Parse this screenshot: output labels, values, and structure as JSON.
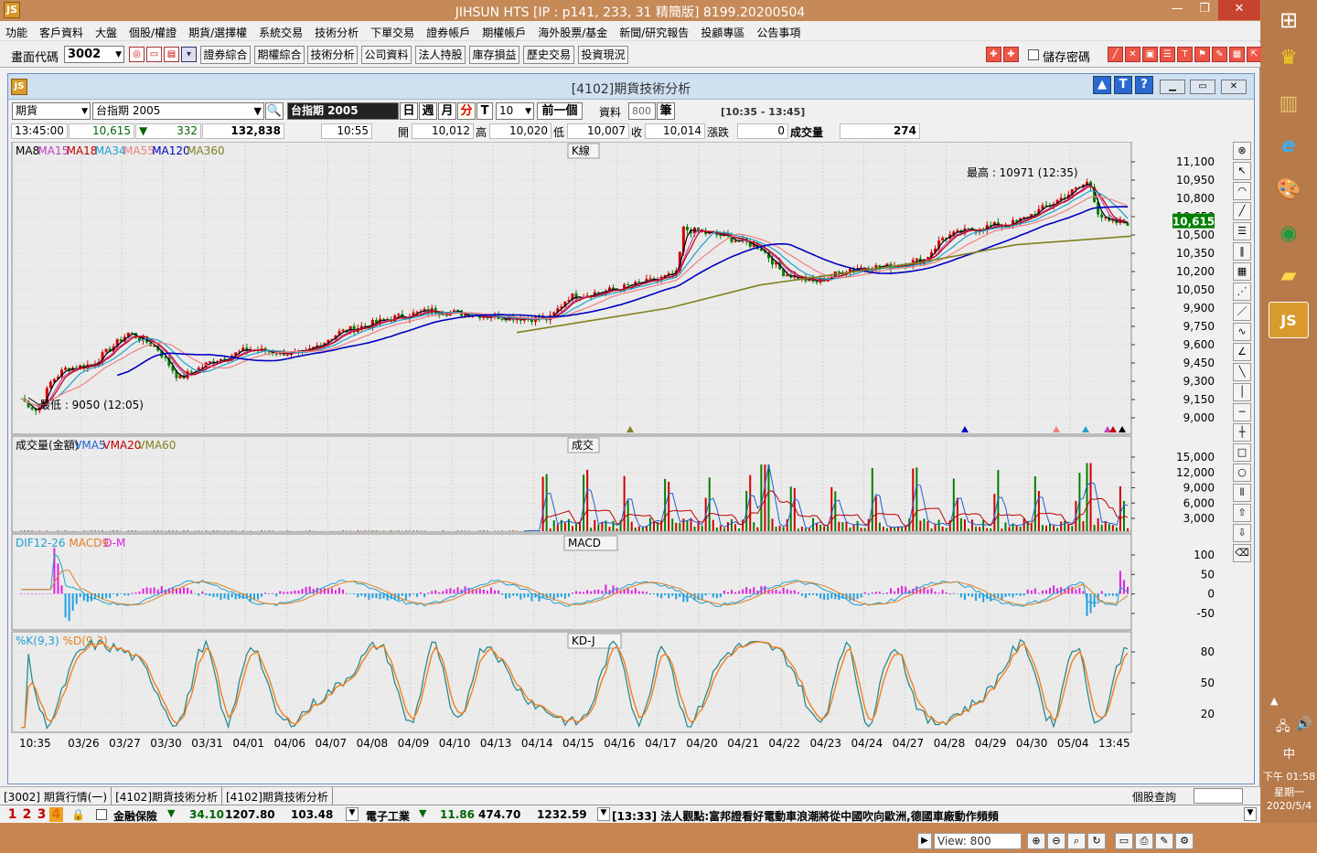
{
  "app": {
    "title": "JIHSUN HTS      [IP : p141, 233, 31 精簡版] 8199.20200504",
    "logo": "JS"
  },
  "menu": [
    "功能",
    "客戶資料",
    "大盤",
    "個股/權證",
    "期貨/選擇權",
    "系統交易",
    "技術分析",
    "下單交易",
    "證券帳戶",
    "期權帳戶",
    "海外股票/基金",
    "新聞/研究報告",
    "投顧專區",
    "公告事項"
  ],
  "toolbar": {
    "code_label": "畫面代碼",
    "code_value": "3002",
    "buttons": [
      "證券綜合",
      "期權綜合",
      "技術分析",
      "公司資料",
      "法人持股",
      "庫存損益",
      "歷史交易",
      "投資現況"
    ],
    "save_password_label": "儲存密碼"
  },
  "child": {
    "title": "[4102]期貨技術分析",
    "type_value": "期貨",
    "symbol_value": "台指期 2005",
    "symbol_display": "台指期 2005",
    "period_day": "日",
    "period_week": "週",
    "period_month": "月",
    "period_min": "分",
    "period_t": "T",
    "interval_value": "10",
    "prev_button": "前一個",
    "data_label": "資料",
    "data_count": "800",
    "count_unit": "筆",
    "time_range": "[10:35 - 13:45]"
  },
  "quote": {
    "time": "13:45:00",
    "price": "10,615",
    "change": "332",
    "volume_total": "132,838",
    "bar_time": "10:55",
    "open_label": "開",
    "open": "10,012",
    "high_label": "高",
    "high": "10,020",
    "low_label": "低",
    "low": "10,007",
    "close_label": "收",
    "close": "10,014",
    "chg_label": "漲跌",
    "chg": "0",
    "vol_label": "成交量",
    "vol": "274"
  },
  "panels": {
    "k": {
      "label": "K線",
      "ma_legend": [
        {
          "name": "MA8",
          "color": "#000000"
        },
        {
          "name": "MA15",
          "color": "#c040c0"
        },
        {
          "name": "MA18",
          "color": "#c00000"
        },
        {
          "name": "MA34",
          "color": "#20a0d0"
        },
        {
          "name": "MA55",
          "color": "#f08080"
        },
        {
          "name": "MA120",
          "color": "#0000c0"
        },
        {
          "name": "MA360",
          "color": "#808020"
        }
      ],
      "y_ticks": [
        "11,100",
        "10,950",
        "10,800",
        "10,650",
        "10,500",
        "10,350",
        "10,200",
        "10,050",
        "9,900",
        "9,750",
        "9,600",
        "9,450",
        "9,300",
        "9,150",
        "9,000"
      ],
      "current_price_tag": "10,615",
      "high_note": "最高 : 10971 (12:35)",
      "low_note": "最低 : 9050 (12:05)"
    },
    "volume": {
      "label": "成交",
      "legend": [
        {
          "name": "成交量(金額)",
          "color": "#000000"
        },
        {
          "name": "VMA5",
          "color": "#2060d0"
        },
        {
          "name": "VMA20",
          "color": "#c00000"
        },
        {
          "name": "VMA60",
          "color": "#808020"
        }
      ],
      "y_ticks": [
        "15,000",
        "12,000",
        "9,000",
        "6,000",
        "3,000"
      ]
    },
    "macd": {
      "label": "MACD",
      "legend": [
        {
          "name": "DIF12-26",
          "color": "#20a0d0"
        },
        {
          "name": "MACD9",
          "color": "#e08020"
        },
        {
          "name": "D-M",
          "color": "#e020e0"
        }
      ],
      "y_ticks": [
        "100",
        "50",
        "0",
        "-50"
      ]
    },
    "kd": {
      "label": "KD-J",
      "legend": [
        {
          "name": "%K(9,3)",
          "color": "#20a0d0"
        },
        {
          "name": "%D(9,3)",
          "color": "#e08020"
        }
      ],
      "y_ticks": [
        "80",
        "50",
        "20"
      ]
    }
  },
  "x_labels": [
    "10:35",
    "03/26",
    "03/27",
    "03/30",
    "03/31",
    "04/01",
    "04/06",
    "04/07",
    "04/08",
    "04/09",
    "04/10",
    "04/13",
    "04/14",
    "04/15",
    "04/16",
    "04/17",
    "04/20",
    "04/21",
    "04/22",
    "04/23",
    "04/24",
    "04/27",
    "04/28",
    "04/29",
    "04/30",
    "05/04",
    "13:45"
  ],
  "view_label": "View: 800",
  "tabs": [
    "[3002] 期貨行情(一)",
    "[4102]期貨技術分析",
    "[4102]期貨技術分析"
  ],
  "stock_query_label": "個股查詢",
  "ticker": {
    "groups": [
      "1",
      "2",
      "3",
      "4"
    ],
    "item1_name": "金融保險",
    "item1_chg": "34.10",
    "item1_val": "1207.80",
    "item1_vol": "103.48",
    "item2_name": "電子工業",
    "item2_chg": "11.86",
    "item2_val": "474.70",
    "item2_vol": "1232.59",
    "news": "[13:33] 法人觀點:富邦證看好電動車浪潮將從中國吹向歐洲,德國車廠動作頻頻"
  },
  "taskbar": {
    "ime": "中",
    "time": "下午 01:58",
    "weekday": "星期一",
    "date": "2020/5/4"
  }
}
